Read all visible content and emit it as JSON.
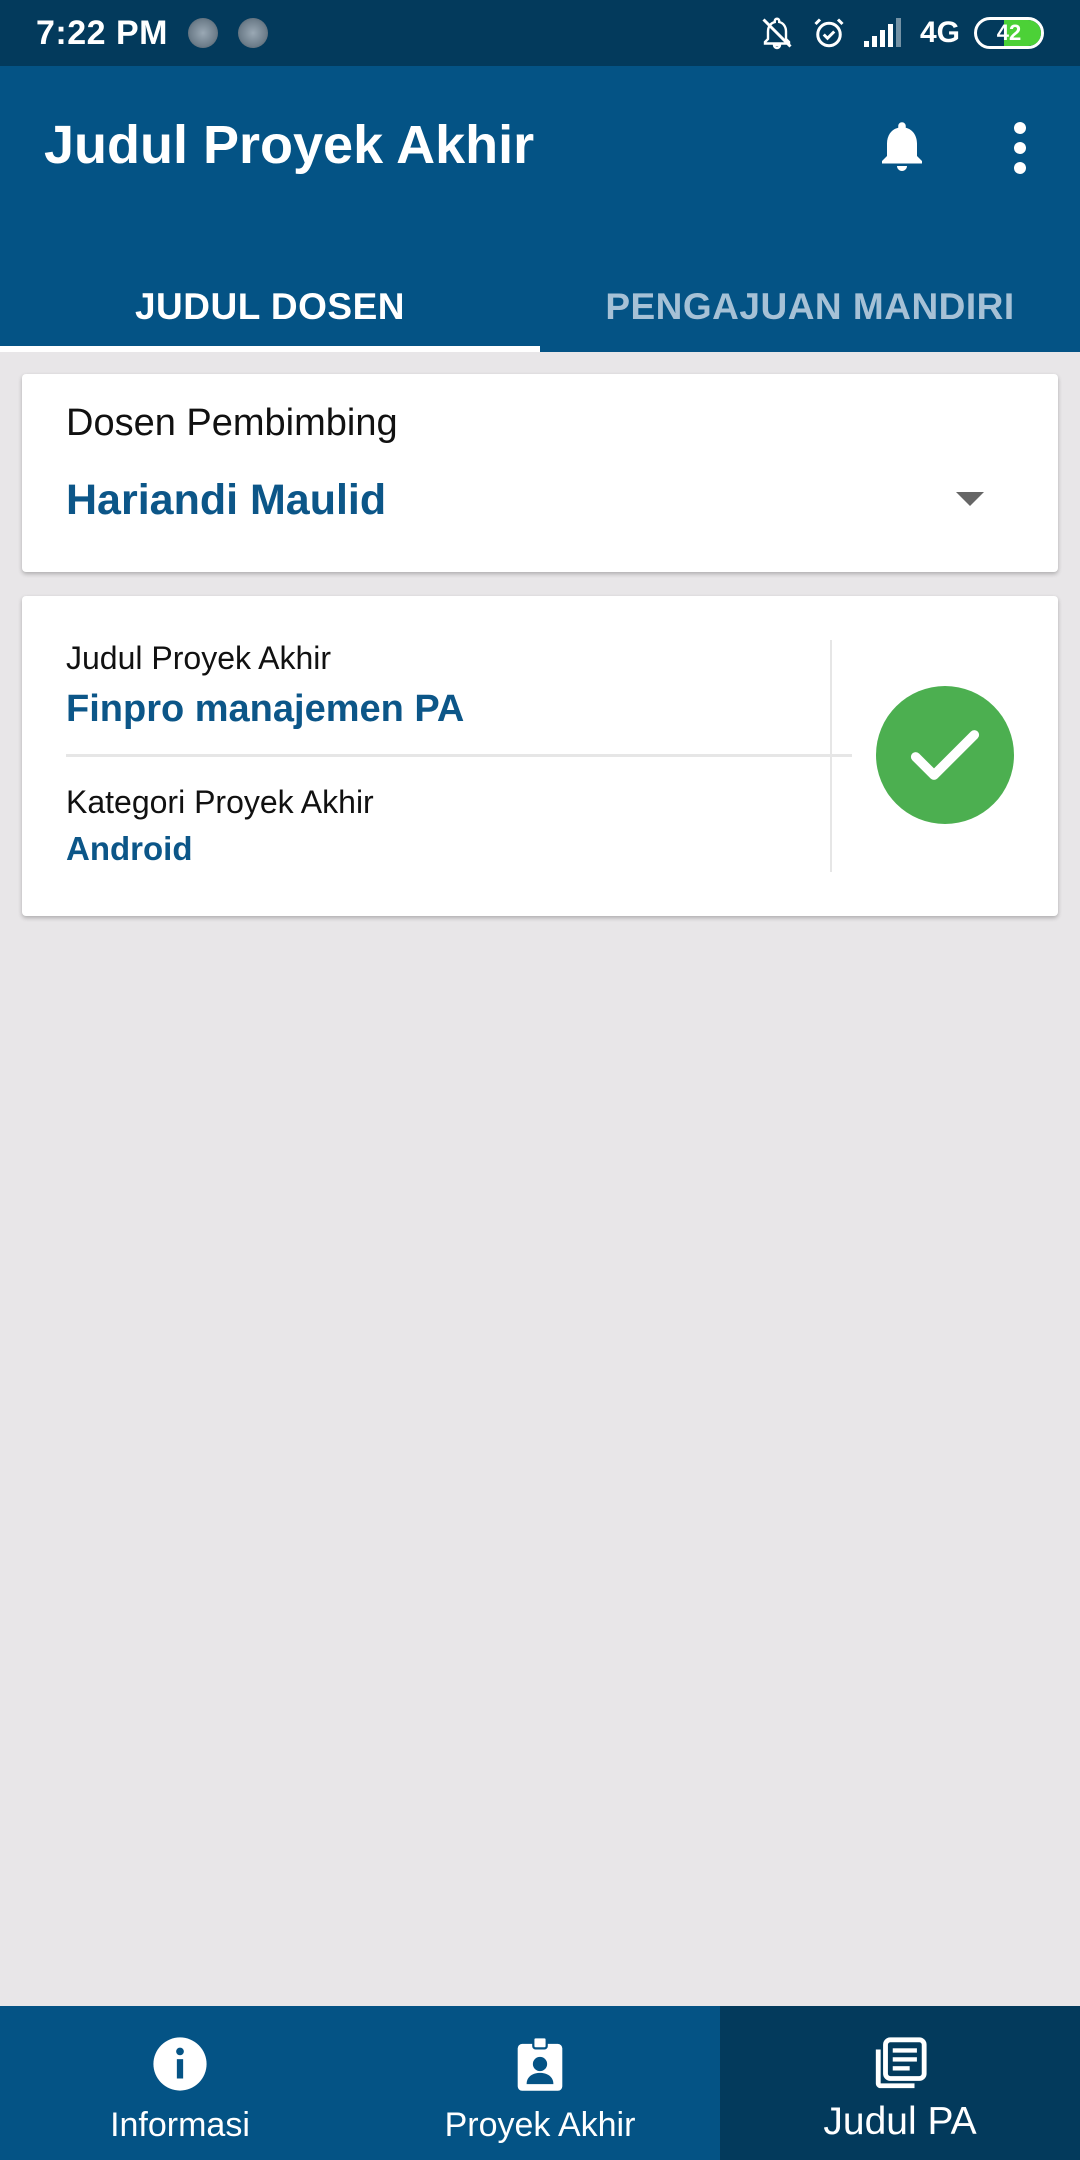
{
  "status_bar": {
    "time": "7:22 PM",
    "network": "4G",
    "battery": "42",
    "icons": [
      "app-notification-icon",
      "app-notification-icon",
      "muted-bell-icon",
      "alarm-icon",
      "signal-icon",
      "battery-icon"
    ]
  },
  "app_bar": {
    "title": "Judul Proyek Akhir",
    "actions": [
      "bell-icon",
      "more-vert-icon"
    ]
  },
  "tabs": [
    {
      "label": "JUDUL DOSEN",
      "active": true
    },
    {
      "label": "PENGAJUAN MANDIRI",
      "active": false
    }
  ],
  "dosen_card": {
    "label": "Dosen Pembimbing",
    "selected": "Hariandi Maulid"
  },
  "judul_card": {
    "title_label": "Judul Proyek Akhir",
    "title_value": "Finpro manajemen PA",
    "category_label": "Kategori Proyek Akhir",
    "category_value": "Android",
    "status_icon": "check-circle-icon"
  },
  "bottom_nav": [
    {
      "label": "Informasi",
      "icon": "info-icon",
      "active": false
    },
    {
      "label": "Proyek Akhir",
      "icon": "badge-icon",
      "active": false
    },
    {
      "label": "Judul PA",
      "icon": "library-books-icon",
      "active": true
    }
  ],
  "colors": {
    "status_bar": "#033a5c",
    "primary": "#045385",
    "accent_text": "#0c5688",
    "success": "#4caf50",
    "background": "#e8e6e8"
  }
}
